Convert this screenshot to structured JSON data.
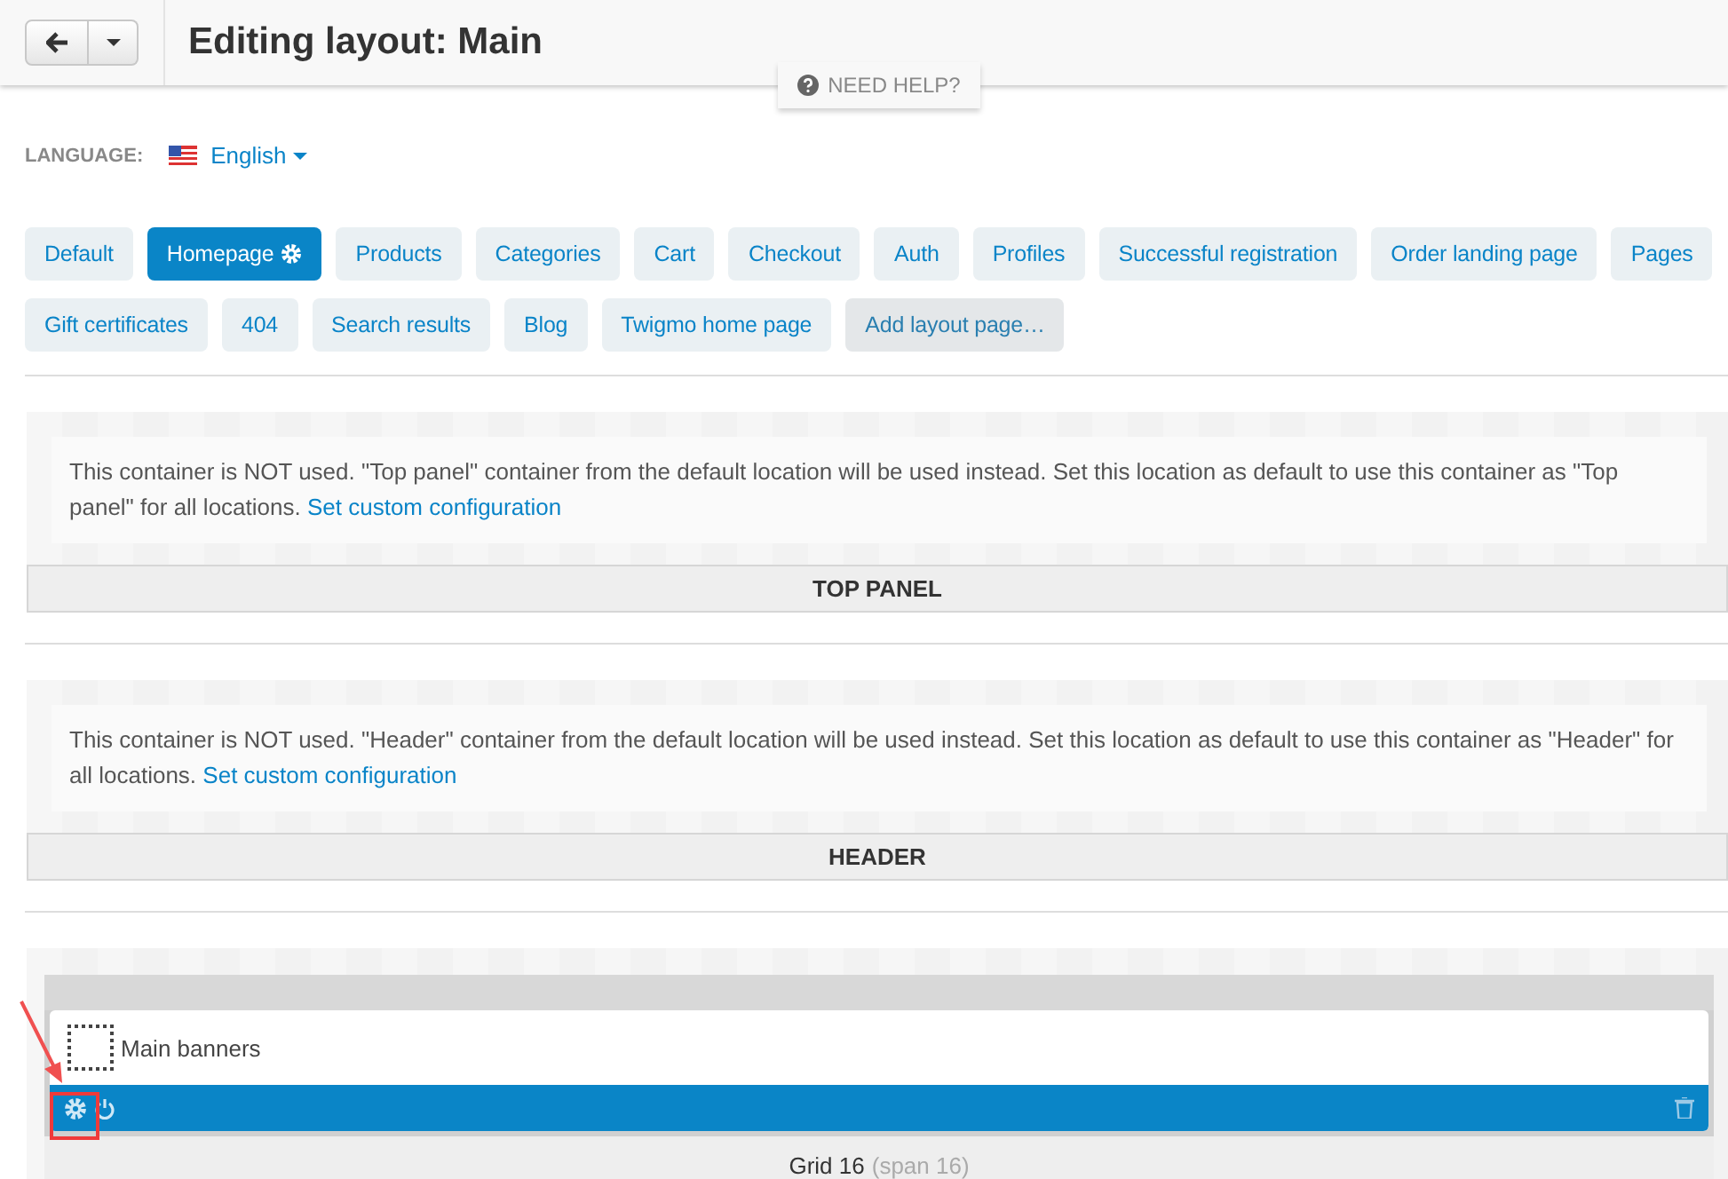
{
  "header": {
    "title": "Editing layout: Main",
    "help": "NEED HELP?"
  },
  "language": {
    "label": "LANGUAGE:",
    "value": "English"
  },
  "tabs": [
    {
      "label": "Default",
      "selected": false,
      "settings": false
    },
    {
      "label": "Homepage",
      "selected": true,
      "settings": true
    },
    {
      "label": "Products",
      "selected": false,
      "settings": false
    },
    {
      "label": "Categories",
      "selected": false,
      "settings": false
    },
    {
      "label": "Cart",
      "selected": false,
      "settings": false
    },
    {
      "label": "Checkout",
      "selected": false,
      "settings": false
    },
    {
      "label": "Auth",
      "selected": false,
      "settings": false
    },
    {
      "label": "Profiles",
      "selected": false,
      "settings": false
    },
    {
      "label": "Successful registration",
      "selected": false,
      "settings": false
    },
    {
      "label": "Order landing page",
      "selected": false,
      "settings": false
    },
    {
      "label": "Pages",
      "selected": false,
      "settings": false
    },
    {
      "label": "Gift certificates",
      "selected": false,
      "settings": false
    },
    {
      "label": "404",
      "selected": false,
      "settings": false
    },
    {
      "label": "Search results",
      "selected": false,
      "settings": false
    },
    {
      "label": "Blog",
      "selected": false,
      "settings": false
    },
    {
      "label": "Twigmo home page",
      "selected": false,
      "settings": false
    }
  ],
  "add_tab": "Add layout page…",
  "containers": [
    {
      "notice": "This container is NOT used. \"Top panel\" container from the default location will be used instead. Set this location as default to use this container as \"Top panel\" for all locations.",
      "link": "Set custom configuration",
      "title": "TOP PANEL"
    },
    {
      "notice": "This container is NOT used. \"Header\" container from the default location will be used instead. Set this location as default to use this container as \"Header\" for all locations.",
      "link": "Set custom configuration",
      "title": "HEADER"
    }
  ],
  "grid": {
    "block": "Main banners",
    "label": "Grid 16",
    "span": "(span 16)"
  }
}
